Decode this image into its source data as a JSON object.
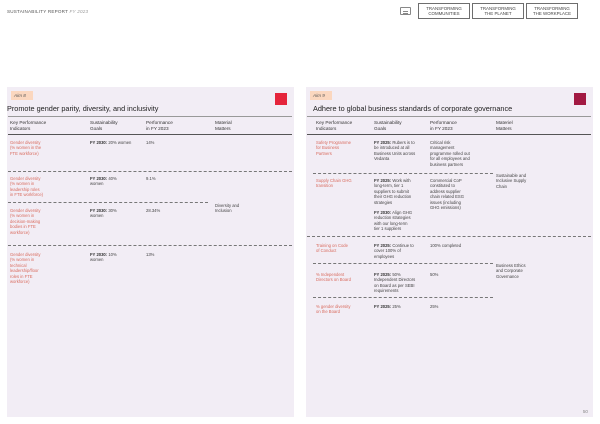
{
  "header": {
    "report": "SUSTAINABILITY REPORT",
    "year": "FY 2023",
    "tabs": [
      {
        "line1": "TRANSFORMING",
        "line2": "COMMUNITIES"
      },
      {
        "line1": "TRANSFORMING",
        "line2": "THE PLANET"
      },
      {
        "line1": "TRANSFORMING",
        "line2": "THE WORKPLACE"
      }
    ]
  },
  "left": {
    "aim": "Aim 8",
    "title": "Promote gender parity, diversity, and inclusivity",
    "columns": [
      {
        "l1": "Key Performance",
        "l2": "Indicators"
      },
      {
        "l1": "Sustainability",
        "l2": "Goals"
      },
      {
        "l1": "Performance",
        "l2": "in FY 2023"
      },
      {
        "l1": "Material",
        "l2": "Matters"
      }
    ],
    "rows": [
      {
        "ind": [
          "Gender diversity",
          "(% women in the",
          "FTE workforce)"
        ],
        "goal_bold": "FY 2030:",
        "goal": [
          " 20% women"
        ],
        "perf": [
          "14%"
        ]
      },
      {
        "ind": [
          "Gender diversity",
          "(% women in",
          "leadership roles",
          "in FTE workforce)"
        ],
        "goal_bold": "FY 2030:",
        "goal": [
          " 40%",
          "women"
        ],
        "perf": [
          "9.1%"
        ]
      },
      {
        "ind": [
          "Gender diversity",
          "(% women in",
          "decision-making",
          "bodies in FTE",
          "workforce)"
        ],
        "goal_bold": "FY 2030:",
        "goal": [
          " 30%",
          "women"
        ],
        "perf": [
          "28.34%"
        ]
      },
      {
        "ind": [
          "Gender diversity",
          "(% women in",
          "technical",
          "leadership/floor",
          "roles in FTE",
          "workforce)"
        ],
        "goal_bold": "FY 2030:",
        "goal": [
          " 10%",
          "women"
        ],
        "perf": [
          "13%"
        ]
      }
    ],
    "matter": [
      "Diversity and",
      "Inclusion"
    ]
  },
  "right": {
    "aim": "Aim 9",
    "title": "Adhere to global business standards of corporate governance",
    "columns": [
      {
        "l1": "Key Performance",
        "l2": "Indicators"
      },
      {
        "l1": "Sustainability",
        "l2": "Goals"
      },
      {
        "l1": "Performance",
        "l2": "in FY 2023"
      },
      {
        "l1": "Materiel",
        "l2": "Matters"
      }
    ],
    "rows": [
      {
        "ind": [
          "Safety Programme",
          "for Business",
          "Partners"
        ],
        "goal_bold": "FY 2025:",
        "goal": [
          " Rubers is to",
          "be introduced at all",
          "Business Units across",
          "Vedanta"
        ],
        "perf": [
          "Critical risk",
          "management",
          "programme rolled out",
          "for all employees and",
          "business partners"
        ]
      },
      {
        "ind": [
          "Supply Chain GHG",
          "transition"
        ],
        "goal_bold": "FY 2025:",
        "goal": [
          " Work with",
          "long-term, tier 1",
          "suppliers to submit",
          "their GHG reduction",
          "strategies",
          "",
          "FY 2030:",
          " Align GHG",
          "reduction strategies",
          "with our long-term",
          "tier 1 suppliers"
        ],
        "perf": [
          "Commercial CoP",
          "constituted to",
          "address supplier",
          "chain related ESG",
          "issues (including",
          "GHG emissions)"
        ]
      },
      {
        "ind": [
          "Training on Code",
          "of Conduct"
        ],
        "goal_bold": "FY 2025:",
        "goal": [
          " Continue to",
          "cover 100% of",
          "employees"
        ],
        "perf": [
          "100% completed"
        ]
      },
      {
        "ind": [
          "% Independent",
          "Directors on Board"
        ],
        "goal_bold": "FY 2025:",
        "goal": [
          " 50%",
          "Independent Directors",
          "on Board as per SEBI",
          "requirements"
        ],
        "perf": [
          "50%"
        ]
      },
      {
        "ind": [
          "% gender diversity",
          "on the Board"
        ],
        "goal_bold": "FY 2025:",
        "goal": [
          " 25%"
        ],
        "perf": [
          "25%"
        ]
      }
    ],
    "matter1": [
      "Sustainable and",
      "Inclusive Supply",
      "Chain"
    ],
    "matter2": [
      "Business Ethics",
      "and Corporate",
      "Governance"
    ]
  },
  "page_number": "50"
}
